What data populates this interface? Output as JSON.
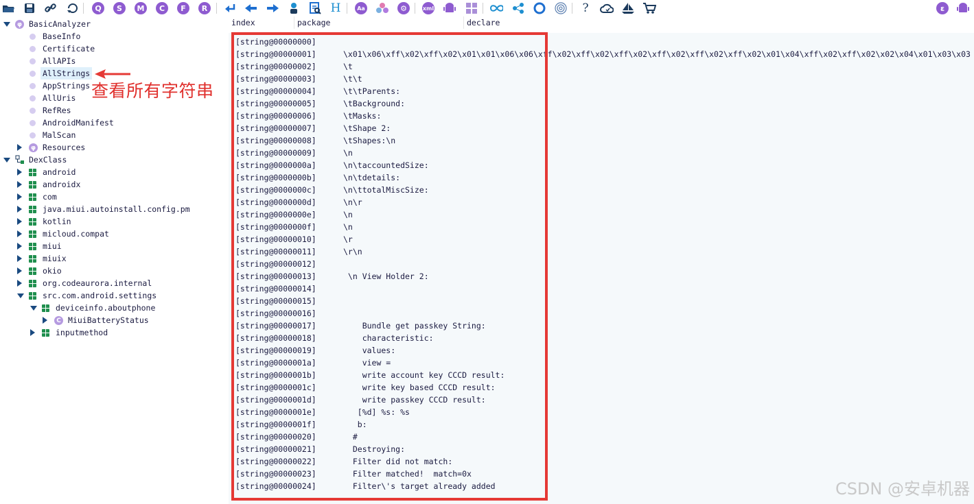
{
  "toolbar": {
    "icons": [
      "open-folder-icon",
      "save-icon",
      "link-icon",
      "refresh-icon",
      "q-icon",
      "s-icon",
      "m-icon",
      "c-icon",
      "f-icon",
      "r-icon",
      "return-icon",
      "arrow-left-icon",
      "arrow-right-icon",
      "person-icon",
      "report-icon",
      "heading-icon",
      "aa-icon",
      "palette-icon",
      "gear-icon",
      "xml-icon",
      "android-icon",
      "windows-icon",
      "infinity-icon",
      "share-icon",
      "ring-icon",
      "fingerprint-icon",
      "help-icon",
      "cloud-icon",
      "boat-icon",
      "cart-icon",
      "e-icon",
      "android-right-icon"
    ],
    "letters": {
      "q": "Q",
      "s": "S",
      "m": "M",
      "c": "C",
      "f": "F",
      "r": "R",
      "h": "H",
      "aa": "Aa",
      "xml": "xml",
      "help": "?",
      "e": "ε"
    }
  },
  "tree": {
    "root": "BasicAnalyzer",
    "basic_items": [
      "BaseInfo",
      "Certificate",
      "AllAPIs",
      "AllStrings",
      "AppStrings",
      "AllUris",
      "RefRes",
      "AndroidManifest",
      "MalScan"
    ],
    "resources": "Resources",
    "dexclass": "DexClass",
    "packages": [
      "android",
      "androidx",
      "com",
      "java.miui.autoinstall.config.pm",
      "kotlin",
      "micloud.compat",
      "miui",
      "miuix",
      "okio",
      "org.codeaurora.internal",
      "src.com.android.settings"
    ],
    "sub_package": "deviceinfo.aboutphone",
    "class_item": "MiuiBatteryStatus",
    "class_letter": "C",
    "last_package": "inputmethod"
  },
  "annotation": "查看所有字符串",
  "columns": [
    "index",
    "package",
    "declare"
  ],
  "rows": [
    {
      "index": "[string@00000000]",
      "value": ""
    },
    {
      "index": "[string@00000001]",
      "value": "\\x01\\x06\\xff\\x02\\xff\\x02\\x01\\x01\\x06\\x06\\xff\\x02\\xff\\x02\\xff\\x02\\xff\\x02\\xff\\x02\\xff\\x02\\x01\\x04\\xff\\x02\\xff\\x02\\x02\\x04\\x01\\x03\\x03"
    },
    {
      "index": "[string@00000002]",
      "value": "\\t"
    },
    {
      "index": "[string@00000003]",
      "value": "\\t\\t"
    },
    {
      "index": "[string@00000004]",
      "value": "\\t\\tParents:"
    },
    {
      "index": "[string@00000005]",
      "value": "\\tBackground:"
    },
    {
      "index": "[string@00000006]",
      "value": "\\tMasks:"
    },
    {
      "index": "[string@00000007]",
      "value": "\\tShape 2:"
    },
    {
      "index": "[string@00000008]",
      "value": "\\tShapes:\\n"
    },
    {
      "index": "[string@00000009]",
      "value": "\\n"
    },
    {
      "index": "[string@0000000a]",
      "value": "\\n\\taccountedSize:"
    },
    {
      "index": "[string@0000000b]",
      "value": "\\n\\tdetails:"
    },
    {
      "index": "[string@0000000c]",
      "value": "\\n\\ttotalMiscSize:"
    },
    {
      "index": "[string@0000000d]",
      "value": "\\n\\r"
    },
    {
      "index": "[string@0000000e]",
      "value": "\\n"
    },
    {
      "index": "[string@0000000f]",
      "value": "\\n"
    },
    {
      "index": "[string@00000010]",
      "value": "\\r"
    },
    {
      "index": "[string@00000011]",
      "value": "\\r\\n"
    },
    {
      "index": "[string@00000012]",
      "value": ""
    },
    {
      "index": "[string@00000013]",
      "value": " \\n View Holder 2:"
    },
    {
      "index": "[string@00000014]",
      "value": ""
    },
    {
      "index": "[string@00000015]",
      "value": ""
    },
    {
      "index": "[string@00000016]",
      "value": ""
    },
    {
      "index": "[string@00000017]",
      "value": "    Bundle get passkey String:"
    },
    {
      "index": "[string@00000018]",
      "value": "    characteristic:"
    },
    {
      "index": "[string@00000019]",
      "value": "    values:"
    },
    {
      "index": "[string@0000001a]",
      "value": "    view ="
    },
    {
      "index": "[string@0000001b]",
      "value": "    write account key CCCD result:"
    },
    {
      "index": "[string@0000001c]",
      "value": "    write key based CCCD result:"
    },
    {
      "index": "[string@0000001d]",
      "value": "    write passkey CCCD result:"
    },
    {
      "index": "[string@0000001e]",
      "value": "   [%d] %s: %s"
    },
    {
      "index": "[string@0000001f]",
      "value": "   b:"
    },
    {
      "index": "[string@00000020]",
      "value": "  #"
    },
    {
      "index": "[string@00000021]",
      "value": "  Destroying:"
    },
    {
      "index": "[string@00000022]",
      "value": "  Filter did not match:"
    },
    {
      "index": "[string@00000023]",
      "value": "  Filter matched!  match=0x"
    },
    {
      "index": "[string@00000024]",
      "value": "  Filter\\'s target already added"
    }
  ],
  "watermark": "CSDN @安卓机器",
  "colors": {
    "annotation_red": "#e53935",
    "package_green": "#1f8f4e",
    "tree_dot": "#d6cdf0",
    "selection": "#dff0fb"
  }
}
